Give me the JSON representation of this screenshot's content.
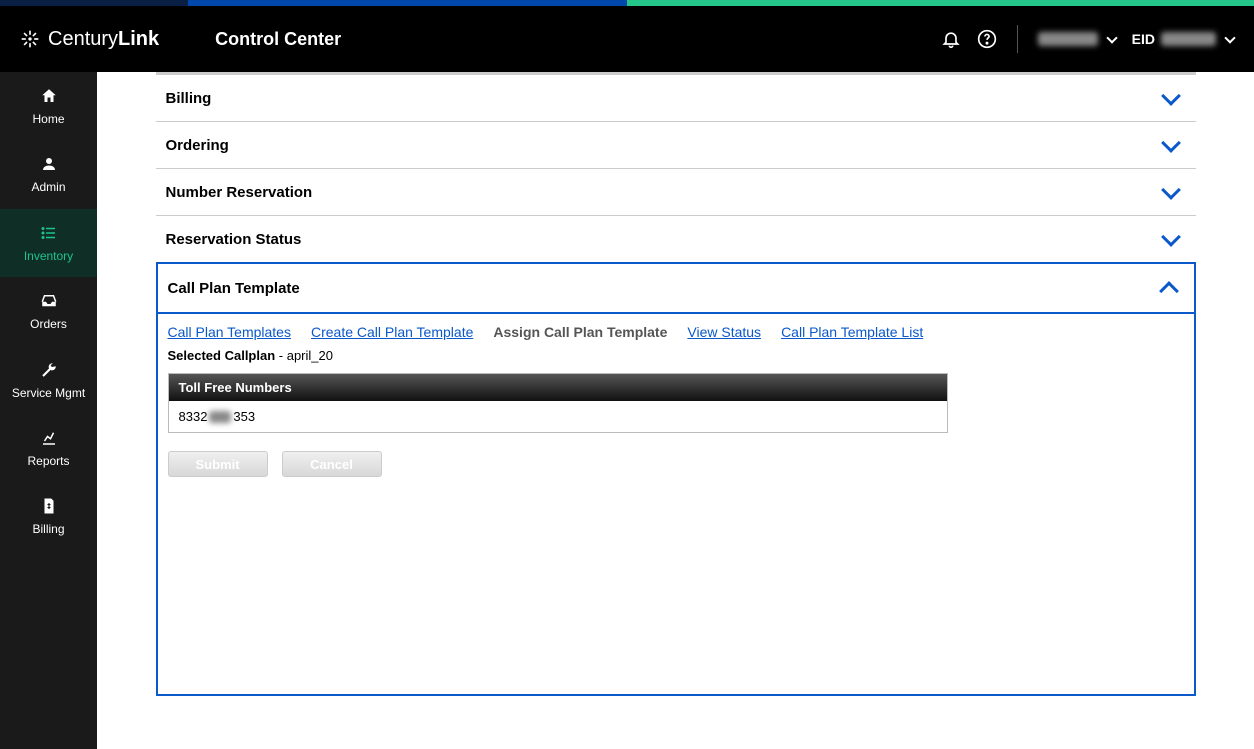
{
  "brand": {
    "part1": "Century",
    "part2": "Link"
  },
  "app_name": "Control Center",
  "header": {
    "eid_label": "EID"
  },
  "sidebar": {
    "items": [
      {
        "label": "Home"
      },
      {
        "label": "Admin"
      },
      {
        "label": "Inventory"
      },
      {
        "label": "Orders"
      },
      {
        "label": "Service Mgmt"
      },
      {
        "label": "Reports"
      },
      {
        "label": "Billing"
      }
    ]
  },
  "accordions": {
    "billing": "Billing",
    "ordering": "Ordering",
    "number_reservation": "Number Reservation",
    "reservation_status": "Reservation Status",
    "call_plan_template": "Call Plan Template"
  },
  "tabs": {
    "call_plan_templates": "Call Plan Templates",
    "create": "Create Call Plan Template",
    "assign": "Assign Call Plan Template",
    "view_status": "View Status",
    "list": "Call Plan Template List"
  },
  "panel": {
    "selected_label": "Selected Callplan",
    "selected_value": "april_20",
    "table_header": "Toll Free Numbers",
    "number_prefix": "8332",
    "number_suffix": "353",
    "submit": "Submit",
    "cancel": "Cancel"
  }
}
